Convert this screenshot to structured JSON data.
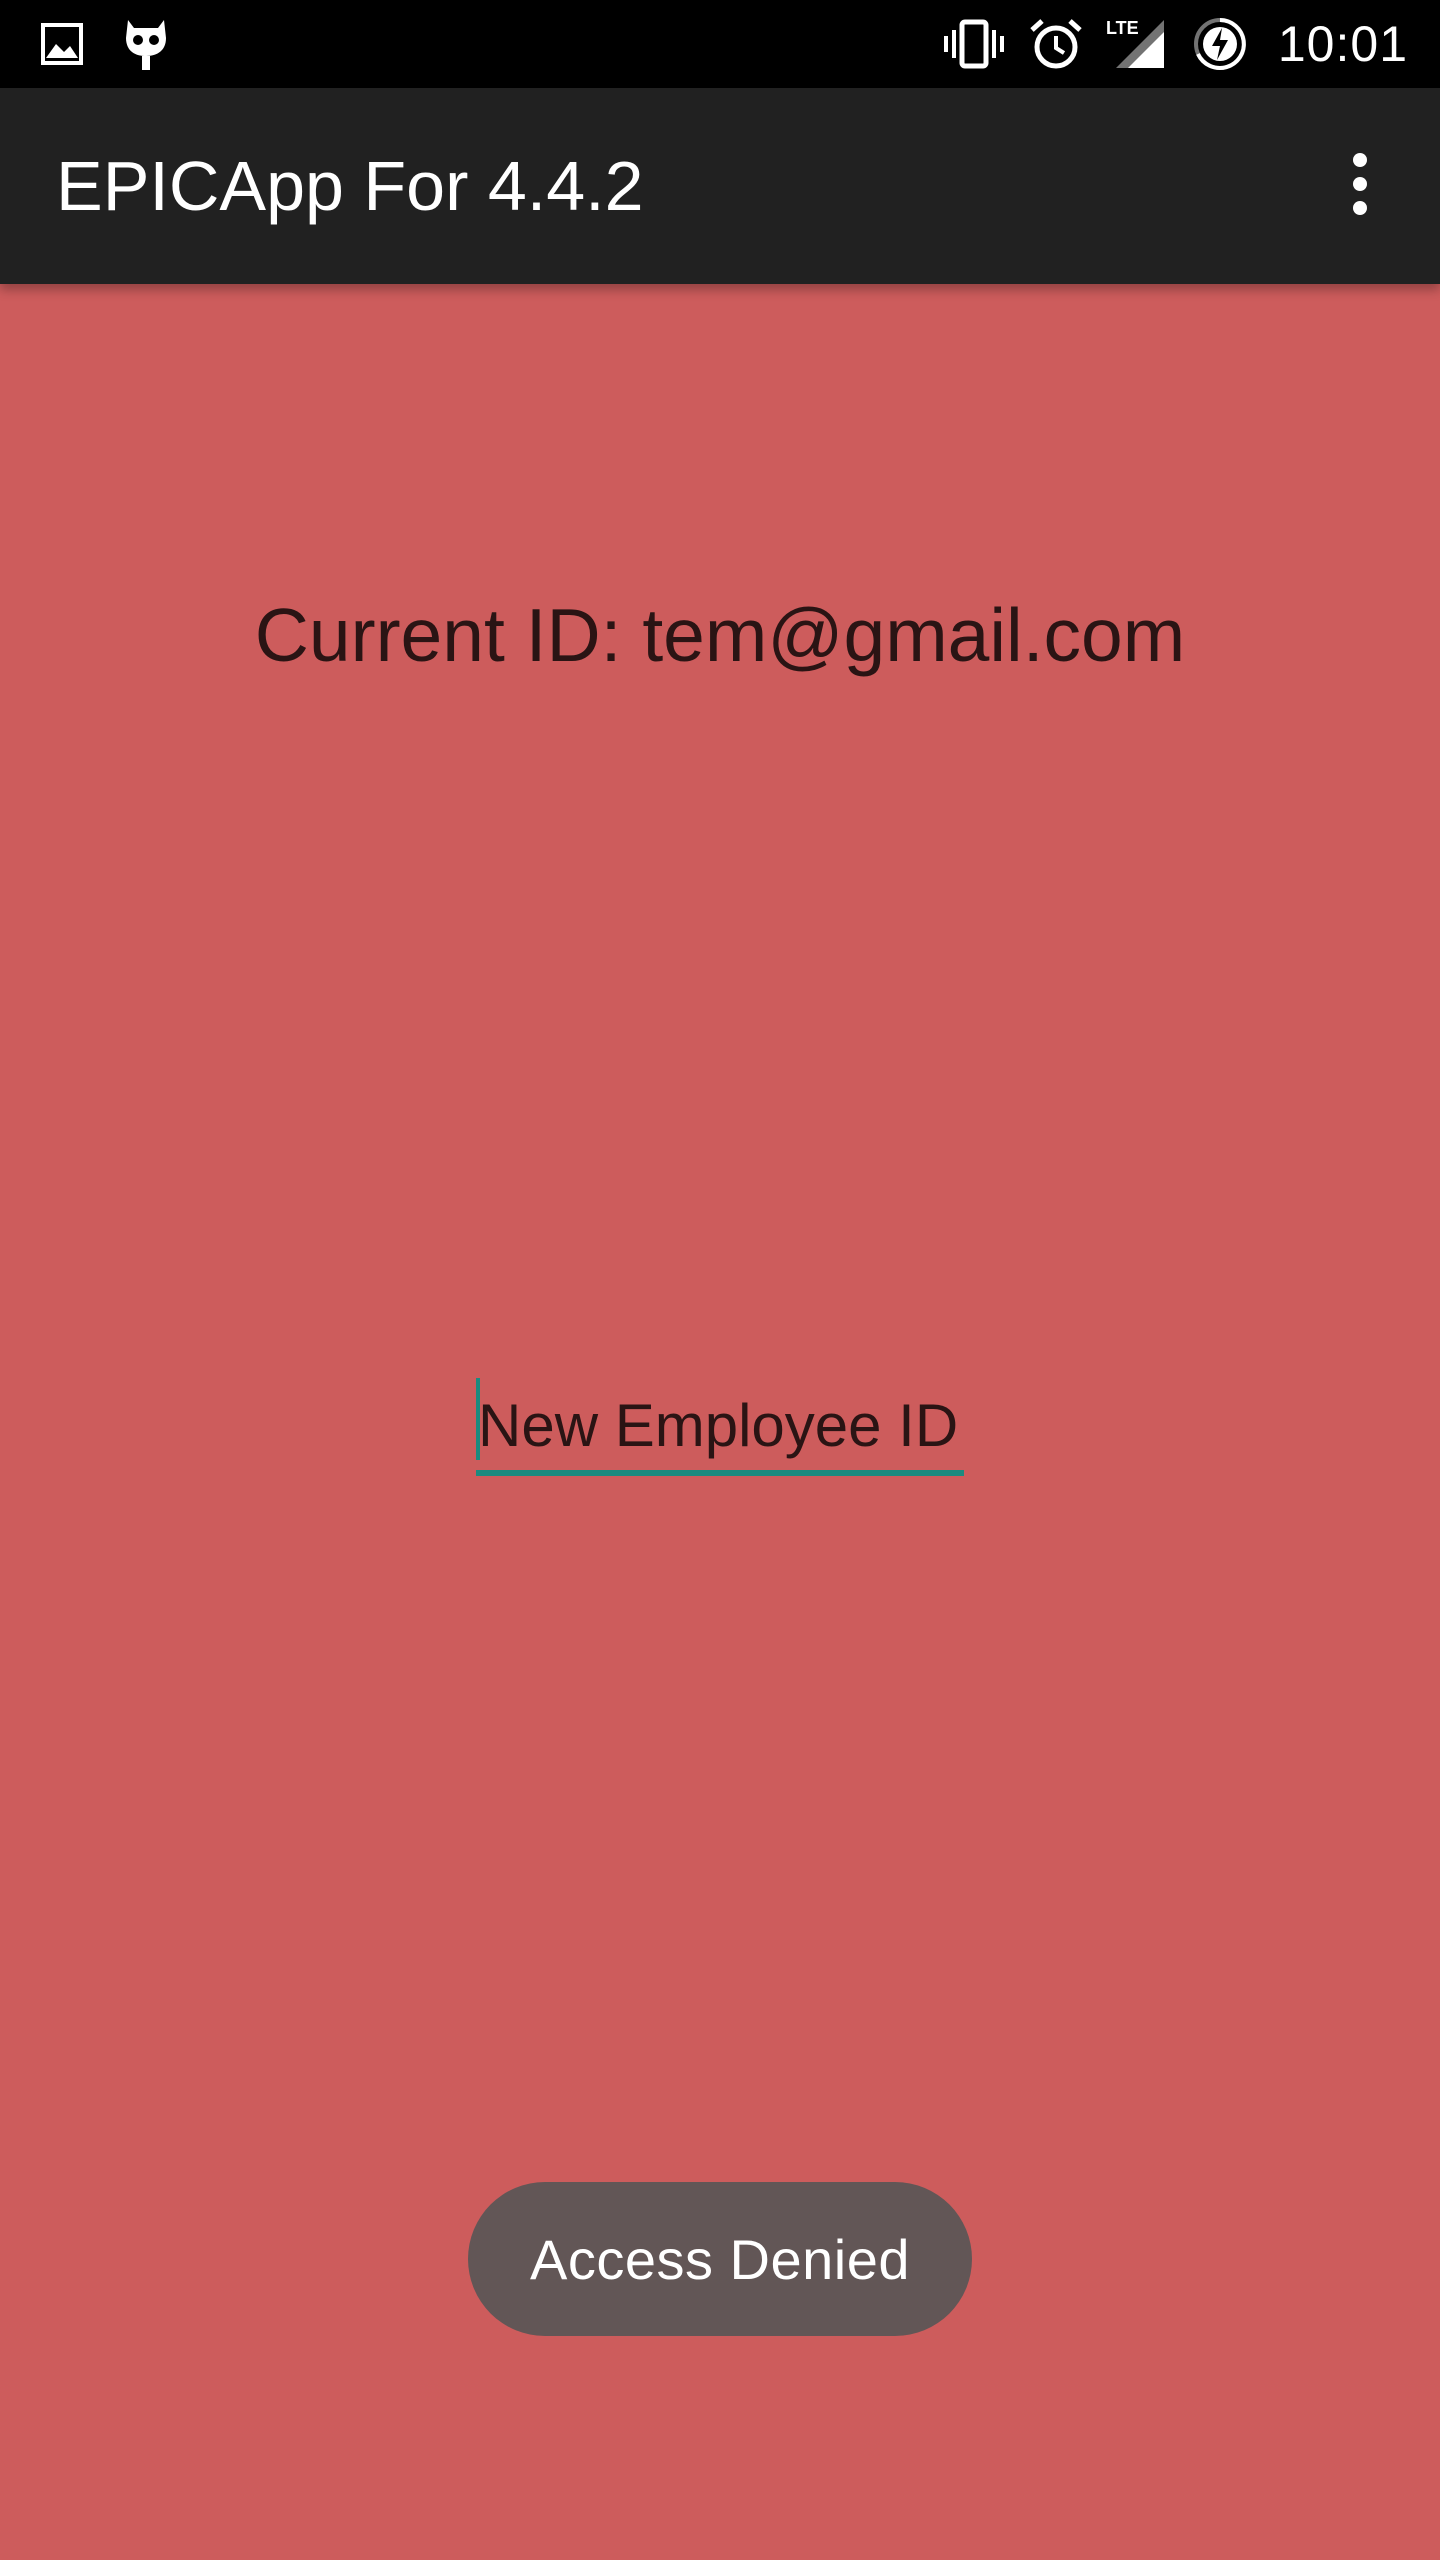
{
  "status_bar": {
    "time": "10:01",
    "network_label": "LTE",
    "icons": {
      "left": [
        "image-notification-icon",
        "cyanogen-mascot-icon"
      ],
      "right": [
        "vibrate-icon",
        "alarm-icon",
        "signal-icon",
        "battery-charging-icon"
      ]
    }
  },
  "app_bar": {
    "title": "EPICApp For 4.4.2",
    "menu_icon": "overflow-menu-icon"
  },
  "main": {
    "current_id_label": "Current ID: tem@gmail.com",
    "employee_id_input": {
      "placeholder": "New Employee ID",
      "value": ""
    }
  },
  "toast": {
    "message": "Access Denied"
  },
  "colors": {
    "background": "#cd5c5c",
    "app_bar": "#212121",
    "status_bar": "#000000",
    "accent": "#1b8a7f",
    "toast": "#625656",
    "text": "#2a1414"
  }
}
